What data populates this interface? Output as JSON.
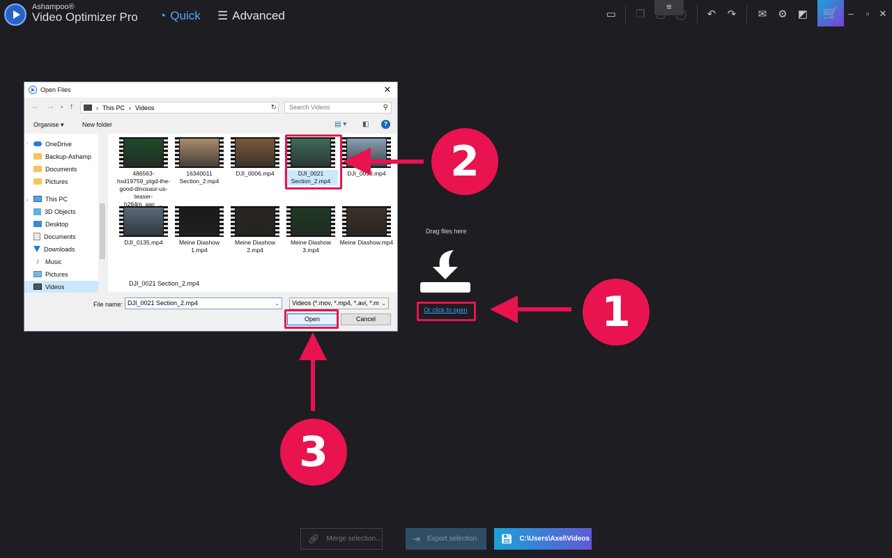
{
  "app": {
    "brand_small": "Ashampoo®",
    "brand_big": "Video Optimizer Pro",
    "modes": {
      "quick": "Quick",
      "advanced": "Advanced"
    },
    "toolbar_icons": [
      "folder-icon",
      "copy-icon",
      "square-icon",
      "circle-icon",
      "undo-icon",
      "redo-icon",
      "mail-icon",
      "gear-icon",
      "theme-icon"
    ],
    "handle_glyph": "≡",
    "cart_glyph": "🛒"
  },
  "dialog": {
    "title": "Open Files",
    "close": "✕",
    "address": {
      "this_pc": "This PC",
      "sep": "›",
      "folder": "Videos"
    },
    "search_placeholder": "Search Videos",
    "organise": "Organise ▾",
    "new_folder": "New folder",
    "help": "?",
    "nav_items": [
      {
        "label": "OneDrive"
      },
      {
        "label": "Backup-Ashamp"
      },
      {
        "label": "Documents"
      },
      {
        "label": "Pictures"
      },
      {
        "label": "This PC"
      },
      {
        "label": "3D Objects"
      },
      {
        "label": "Desktop"
      },
      {
        "label": "Documents"
      },
      {
        "label": "Downloads"
      },
      {
        "label": "Music"
      },
      {
        "label": "Pictures"
      },
      {
        "label": "Videos"
      }
    ],
    "files": [
      {
        "name": "486563-hxd19759_ptgd-the-good-dinosaur-us-teaser-h264m_aac_...",
        "color": "#1f4a2a"
      },
      {
        "name": "16340011 Section_2.mp4",
        "color": "#a88c6e"
      },
      {
        "name": "DJI_0006.mp4",
        "color": "#7a5a3a"
      },
      {
        "name": "DJI_0021 Section_2.mp4",
        "color": "#3f6a5a"
      },
      {
        "name": "DJI_0038.mp4",
        "color": "#8aa0b4"
      },
      {
        "name": "DJI_0135.mp4",
        "color": "#5a6a7a"
      },
      {
        "name": "Meine Diashow 1.mp4",
        "color": "#1a1a1a"
      },
      {
        "name": "Meine Diashow 2.mp4",
        "color": "#2a2520"
      },
      {
        "name": "Meine Diashow 3.mp4",
        "color": "#1f3a24"
      },
      {
        "name": "Meine Diashow.mp4",
        "color": "#3a3028"
      }
    ],
    "selected_name": "DJI_0021 Section_2.mp4",
    "file_name_label": "File name:",
    "file_name_value": "DJI_0021 Section_2.mp4",
    "file_type": "Videos (*.mov, *.mp4, *.avi, *.m",
    "open": "Open",
    "cancel": "Cancel"
  },
  "dropzone": {
    "drag_text": "Drag files here",
    "click_open": "Or click to open"
  },
  "annotations": {
    "one": "1",
    "two": "2",
    "three": "3"
  },
  "bottom": {
    "merge": "Merge selection...",
    "export": "Export selection",
    "path": "C:\\Users\\Axel\\Videos"
  },
  "colors": {
    "accent": "#e8134f",
    "link": "#3ea0ff",
    "quick": "#5aa7ff"
  }
}
